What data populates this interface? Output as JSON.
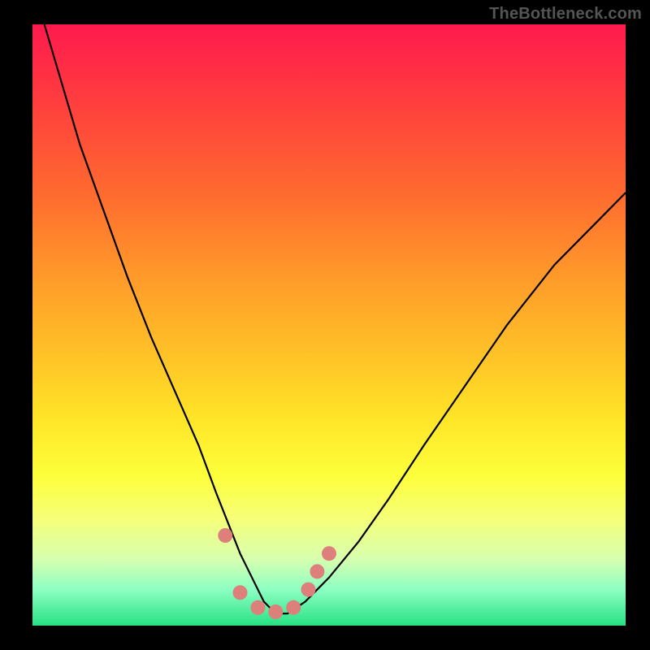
{
  "watermark": "TheBottleneck.com",
  "colors": {
    "dot": "#dd7f7a",
    "curve": "#000000",
    "frame": "#000000"
  },
  "chart_data": {
    "type": "line",
    "title": "",
    "xlabel": "",
    "ylabel": "",
    "xlim": [
      0,
      100
    ],
    "ylim": [
      0,
      100
    ],
    "grid": false,
    "legend": false,
    "series": [
      {
        "name": "curve",
        "x": [
          2,
          5,
          8,
          12,
          16,
          20,
          24,
          28,
          31,
          33,
          35,
          37,
          39,
          41,
          43,
          46,
          50,
          55,
          60,
          66,
          73,
          80,
          88,
          96,
          100
        ],
        "y": [
          100,
          90,
          80,
          69,
          58,
          48,
          39,
          30,
          22,
          17,
          12,
          8,
          4,
          2,
          2,
          4,
          8,
          14,
          21,
          30,
          40,
          50,
          60,
          68,
          72
        ]
      }
    ],
    "markers": [
      {
        "x": 32.5,
        "y": 15
      },
      {
        "x": 35,
        "y": 5.5
      },
      {
        "x": 38,
        "y": 3
      },
      {
        "x": 41,
        "y": 2.3
      },
      {
        "x": 44,
        "y": 3
      },
      {
        "x": 46.5,
        "y": 6
      },
      {
        "x": 48,
        "y": 9
      },
      {
        "x": 50,
        "y": 12
      }
    ]
  }
}
